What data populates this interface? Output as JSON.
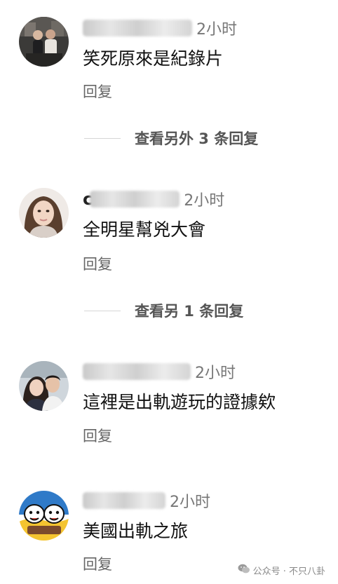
{
  "comments": [
    {
      "name_prefix": "",
      "time": "2小时",
      "text": "笑死原來是紀錄片",
      "reply_label": "回复",
      "more_replies": "查看另外 3 条回复"
    },
    {
      "name_prefix": "c",
      "time": "2小时",
      "text": "全明星幫兇大會",
      "reply_label": "回复",
      "more_replies": "查看另 1 条回复"
    },
    {
      "name_prefix": "",
      "time": "2小时",
      "text": "這裡是出軌遊玩的證據欸",
      "reply_label": "回复",
      "more_replies": ""
    },
    {
      "name_prefix": "",
      "time": "2小时",
      "text": "美國出軌之旅",
      "reply_label": "回复",
      "more_replies": ""
    }
  ],
  "watermark": {
    "text": "公众号 · 不只八卦",
    "icon": "wechat-icon"
  },
  "colors": {
    "text": "#111111",
    "muted": "#777777",
    "reply": "#666666",
    "background": "#ffffff"
  }
}
